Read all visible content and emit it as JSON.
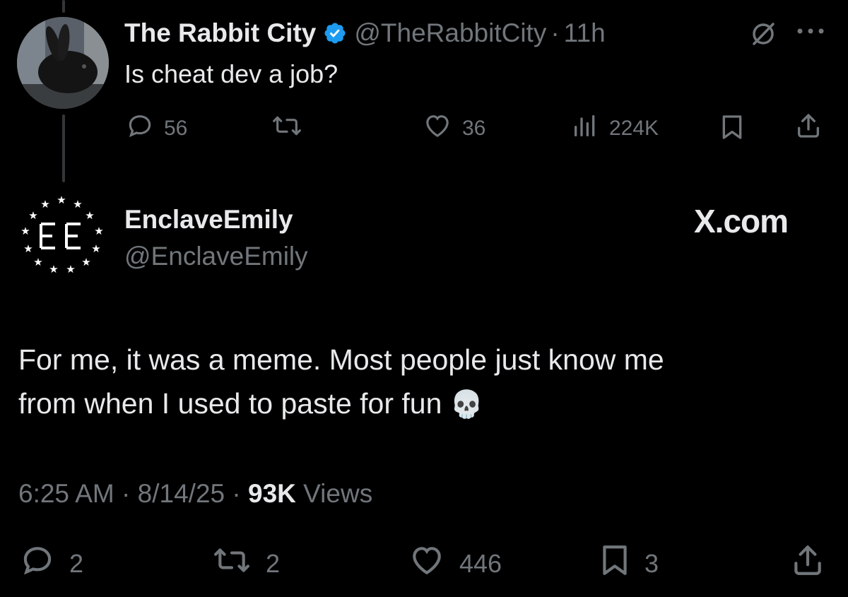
{
  "parent_tweet": {
    "display_name": "The Rabbit City",
    "handle": "@TheRabbitCity",
    "separator": "·",
    "time": "11h",
    "text": "Is cheat dev a job?",
    "replies": "56",
    "likes": "36",
    "views": "224K"
  },
  "main_tweet": {
    "display_name": "EnclaveEmily",
    "handle": "@EnclaveEmily",
    "watermark": "X.com",
    "text_line1": "For me, it was a meme. Most people just know me",
    "text_line2": "from when I used to paste for fun",
    "emoji": "💀",
    "time": "6:25 AM",
    "date": "8/14/25",
    "views_count": "93K",
    "views_label": "Views",
    "sep": "·",
    "replies": "2",
    "reposts": "2",
    "likes": "446",
    "bookmarks": "3"
  },
  "colors": {
    "background": "#000000",
    "text": "#e7e9ea",
    "muted": "#71767b",
    "verified": "#1d9bf0"
  }
}
